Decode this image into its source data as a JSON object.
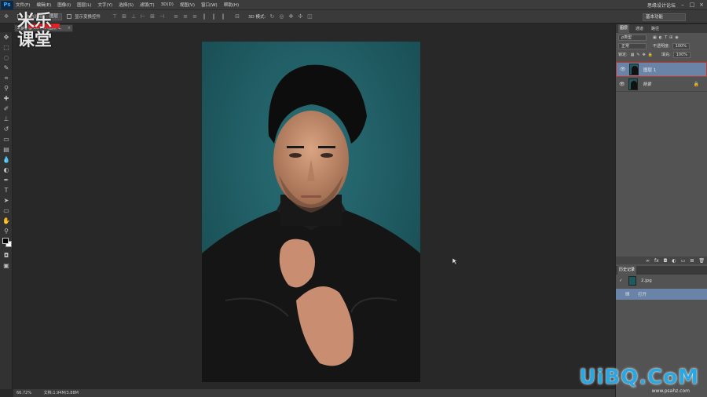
{
  "menubar": {
    "app_logo": "Ps",
    "items": [
      "文件(F)",
      "编辑(E)",
      "图像(I)",
      "图层(L)",
      "文字(Y)",
      "选择(S)",
      "滤镜(T)",
      "3D(D)",
      "视图(V)",
      "窗口(W)",
      "帮助(H)"
    ],
    "right_text": "思缘设计论坛"
  },
  "optionsbar": {
    "auto_select_label": "自动选择",
    "target_select": "图层",
    "show_transform_label": "显示变换控件",
    "mode_3d_label": "3D 模式:",
    "workspace": "基本功能"
  },
  "brand": {
    "line1": "米乐",
    "line2": "课堂"
  },
  "document": {
    "tab_label": "2.jpg @ 66.7% (图层 1, RGB/8)",
    "zoom": "66.72%",
    "doc_info": "文档:1.94M/3.88M"
  },
  "layers_panel": {
    "tabs": [
      "图层",
      "通道",
      "路径"
    ],
    "filter_kind": "ρ类型",
    "blend_mode": "正常",
    "opacity_label": "不透明度:",
    "opacity_value": "100%",
    "lock_label": "锁定:",
    "fill_label": "填充:",
    "fill_value": "100%",
    "layers": [
      {
        "name": "图层 1",
        "selected": true
      },
      {
        "name": "背景",
        "selected": false,
        "locked": true
      }
    ]
  },
  "history_panel": {
    "tab": "历史记录",
    "snapshot": "2.jpg",
    "states": [
      "打开"
    ]
  },
  "watermark": {
    "site_logo": "UiBQ.CoM",
    "site_sub": "www.psahz.com"
  },
  "colors": {
    "photo_bg": "#1f5a60",
    "selection": "#6a84a8"
  }
}
